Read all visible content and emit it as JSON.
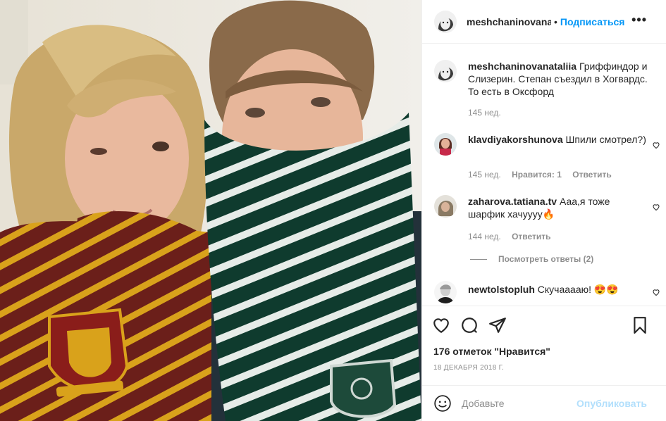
{
  "post": {
    "username": "meshchaninovana",
    "dot": "•",
    "follow_label": "Подписаться",
    "more_label": "•••"
  },
  "caption": {
    "username": "meshchaninovanataliia",
    "text": "Гриффиндор и Слизерин. Степан съездил в Хогвардс. То есть в Оксфорд",
    "time": "145 нед."
  },
  "comments": [
    {
      "username": "klavdiyakorshunova",
      "text": "Шпили смотрел?)",
      "time": "145 нед.",
      "likes": "Нравится: 1",
      "reply": "Ответить"
    },
    {
      "username": "zaharova.tatiana.tv",
      "text": "Ааа,я тоже шарфик хачуууу🔥",
      "time": "144 нед.",
      "reply": "Ответить",
      "view_replies": "Посмотреть ответы (2)"
    },
    {
      "username": "newtolstopluh",
      "text": "Скучааааю! 😍😍"
    }
  ],
  "actions": {
    "like_icon": "heart-icon",
    "comment_icon": "comment-icon",
    "share_icon": "share-icon",
    "save_icon": "bookmark-icon"
  },
  "likes_text": "176 отметок \"Нравится\"",
  "date_text": "18 ДЕКАБРЯ 2018 Г.",
  "add_comment": {
    "placeholder": "Добавьте",
    "publish_label": "Опубликовать",
    "emoji_icon": "smiley-icon"
  },
  "colors": {
    "accent": "#0095f6",
    "publish_disabled": "#b2dffc",
    "muted": "#8e8e8e",
    "gryffindor_red": "#6b1f1a",
    "gryffindor_gold": "#d9a21b",
    "slytherin_green": "#0f3b2e",
    "slytherin_silver": "#e6ece8"
  }
}
